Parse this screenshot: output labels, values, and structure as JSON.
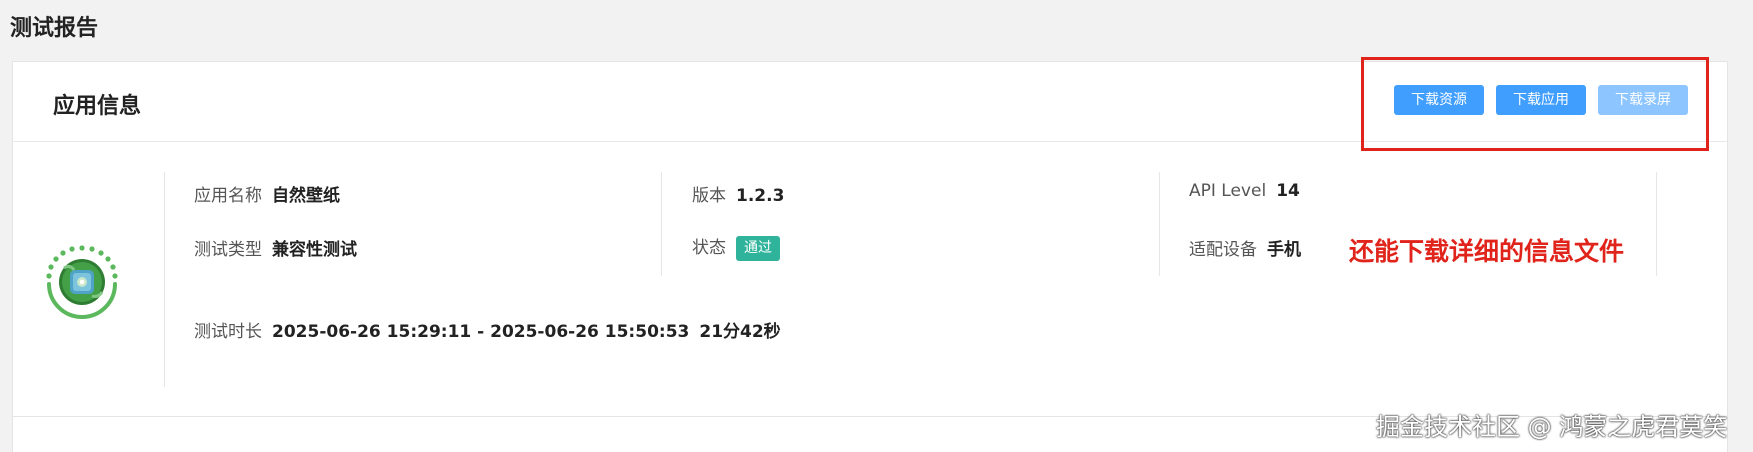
{
  "page_title": "测试报告",
  "card": {
    "title": "应用信息",
    "buttons": {
      "download_resources": "下载资源",
      "download_app": "下载应用",
      "download_recording": "下载录屏"
    }
  },
  "app_info": {
    "app_name_label": "应用名称",
    "app_name_value": "自然壁纸",
    "test_type_label": "测试类型",
    "test_type_value": "兼容性测试",
    "version_label": "版本",
    "version_value": "1.2.3",
    "status_label": "状态",
    "status_value": "通过",
    "api_level_label": "API Level",
    "api_level_value": "14",
    "device_label": "适配设备",
    "device_value": "手机",
    "duration_label": "测试时长",
    "duration_range": "2025-06-26 15:29:11 - 2025-06-26 15:50:53",
    "duration_total": "21分42秒"
  },
  "annotation": "还能下载详细的信息文件",
  "watermark": "掘金技术社区 @ 鸿蒙之虎君莫笑",
  "colors": {
    "primary_button": "#409eff",
    "disabled_button": "#8cc5ff",
    "status_badge": "#2fb39b",
    "highlight_red": "#e0241b"
  },
  "icons": {
    "app_logo": "green-circle-app-logo"
  }
}
